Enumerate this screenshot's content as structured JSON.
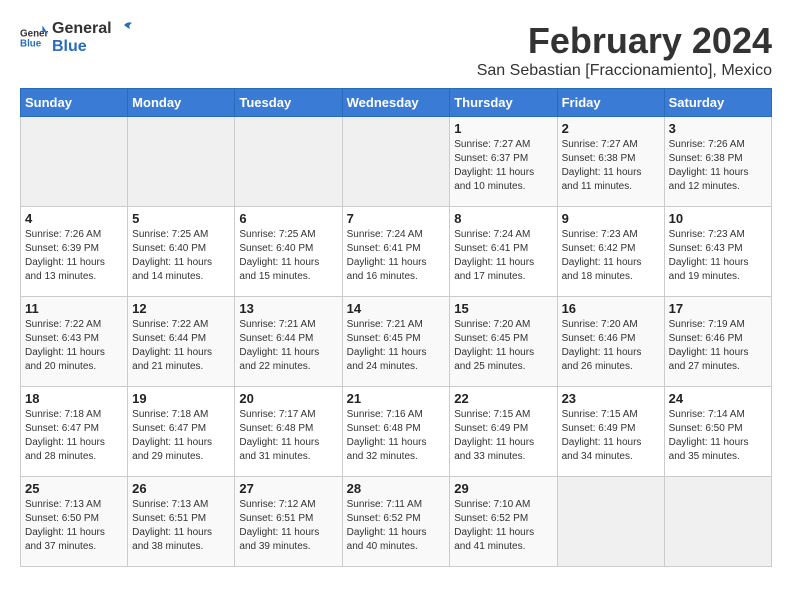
{
  "logo": {
    "general": "General",
    "blue": "Blue"
  },
  "title": "February 2024",
  "subtitle": "San Sebastian [Fraccionamiento], Mexico",
  "days_of_week": [
    "Sunday",
    "Monday",
    "Tuesday",
    "Wednesday",
    "Thursday",
    "Friday",
    "Saturday"
  ],
  "weeks": [
    [
      {
        "date": "",
        "info": ""
      },
      {
        "date": "",
        "info": ""
      },
      {
        "date": "",
        "info": ""
      },
      {
        "date": "",
        "info": ""
      },
      {
        "date": "1",
        "sunrise": "Sunrise: 7:27 AM",
        "sunset": "Sunset: 6:37 PM",
        "daylight": "Daylight: 11 hours and 10 minutes."
      },
      {
        "date": "2",
        "sunrise": "Sunrise: 7:27 AM",
        "sunset": "Sunset: 6:38 PM",
        "daylight": "Daylight: 11 hours and 11 minutes."
      },
      {
        "date": "3",
        "sunrise": "Sunrise: 7:26 AM",
        "sunset": "Sunset: 6:38 PM",
        "daylight": "Daylight: 11 hours and 12 minutes."
      }
    ],
    [
      {
        "date": "4",
        "sunrise": "Sunrise: 7:26 AM",
        "sunset": "Sunset: 6:39 PM",
        "daylight": "Daylight: 11 hours and 13 minutes."
      },
      {
        "date": "5",
        "sunrise": "Sunrise: 7:25 AM",
        "sunset": "Sunset: 6:40 PM",
        "daylight": "Daylight: 11 hours and 14 minutes."
      },
      {
        "date": "6",
        "sunrise": "Sunrise: 7:25 AM",
        "sunset": "Sunset: 6:40 PM",
        "daylight": "Daylight: 11 hours and 15 minutes."
      },
      {
        "date": "7",
        "sunrise": "Sunrise: 7:24 AM",
        "sunset": "Sunset: 6:41 PM",
        "daylight": "Daylight: 11 hours and 16 minutes."
      },
      {
        "date": "8",
        "sunrise": "Sunrise: 7:24 AM",
        "sunset": "Sunset: 6:41 PM",
        "daylight": "Daylight: 11 hours and 17 minutes."
      },
      {
        "date": "9",
        "sunrise": "Sunrise: 7:23 AM",
        "sunset": "Sunset: 6:42 PM",
        "daylight": "Daylight: 11 hours and 18 minutes."
      },
      {
        "date": "10",
        "sunrise": "Sunrise: 7:23 AM",
        "sunset": "Sunset: 6:43 PM",
        "daylight": "Daylight: 11 hours and 19 minutes."
      }
    ],
    [
      {
        "date": "11",
        "sunrise": "Sunrise: 7:22 AM",
        "sunset": "Sunset: 6:43 PM",
        "daylight": "Daylight: 11 hours and 20 minutes."
      },
      {
        "date": "12",
        "sunrise": "Sunrise: 7:22 AM",
        "sunset": "Sunset: 6:44 PM",
        "daylight": "Daylight: 11 hours and 21 minutes."
      },
      {
        "date": "13",
        "sunrise": "Sunrise: 7:21 AM",
        "sunset": "Sunset: 6:44 PM",
        "daylight": "Daylight: 11 hours and 22 minutes."
      },
      {
        "date": "14",
        "sunrise": "Sunrise: 7:21 AM",
        "sunset": "Sunset: 6:45 PM",
        "daylight": "Daylight: 11 hours and 24 minutes."
      },
      {
        "date": "15",
        "sunrise": "Sunrise: 7:20 AM",
        "sunset": "Sunset: 6:45 PM",
        "daylight": "Daylight: 11 hours and 25 minutes."
      },
      {
        "date": "16",
        "sunrise": "Sunrise: 7:20 AM",
        "sunset": "Sunset: 6:46 PM",
        "daylight": "Daylight: 11 hours and 26 minutes."
      },
      {
        "date": "17",
        "sunrise": "Sunrise: 7:19 AM",
        "sunset": "Sunset: 6:46 PM",
        "daylight": "Daylight: 11 hours and 27 minutes."
      }
    ],
    [
      {
        "date": "18",
        "sunrise": "Sunrise: 7:18 AM",
        "sunset": "Sunset: 6:47 PM",
        "daylight": "Daylight: 11 hours and 28 minutes."
      },
      {
        "date": "19",
        "sunrise": "Sunrise: 7:18 AM",
        "sunset": "Sunset: 6:47 PM",
        "daylight": "Daylight: 11 hours and 29 minutes."
      },
      {
        "date": "20",
        "sunrise": "Sunrise: 7:17 AM",
        "sunset": "Sunset: 6:48 PM",
        "daylight": "Daylight: 11 hours and 31 minutes."
      },
      {
        "date": "21",
        "sunrise": "Sunrise: 7:16 AM",
        "sunset": "Sunset: 6:48 PM",
        "daylight": "Daylight: 11 hours and 32 minutes."
      },
      {
        "date": "22",
        "sunrise": "Sunrise: 7:15 AM",
        "sunset": "Sunset: 6:49 PM",
        "daylight": "Daylight: 11 hours and 33 minutes."
      },
      {
        "date": "23",
        "sunrise": "Sunrise: 7:15 AM",
        "sunset": "Sunset: 6:49 PM",
        "daylight": "Daylight: 11 hours and 34 minutes."
      },
      {
        "date": "24",
        "sunrise": "Sunrise: 7:14 AM",
        "sunset": "Sunset: 6:50 PM",
        "daylight": "Daylight: 11 hours and 35 minutes."
      }
    ],
    [
      {
        "date": "25",
        "sunrise": "Sunrise: 7:13 AM",
        "sunset": "Sunset: 6:50 PM",
        "daylight": "Daylight: 11 hours and 37 minutes."
      },
      {
        "date": "26",
        "sunrise": "Sunrise: 7:13 AM",
        "sunset": "Sunset: 6:51 PM",
        "daylight": "Daylight: 11 hours and 38 minutes."
      },
      {
        "date": "27",
        "sunrise": "Sunrise: 7:12 AM",
        "sunset": "Sunset: 6:51 PM",
        "daylight": "Daylight: 11 hours and 39 minutes."
      },
      {
        "date": "28",
        "sunrise": "Sunrise: 7:11 AM",
        "sunset": "Sunset: 6:52 PM",
        "daylight": "Daylight: 11 hours and 40 minutes."
      },
      {
        "date": "29",
        "sunrise": "Sunrise: 7:10 AM",
        "sunset": "Sunset: 6:52 PM",
        "daylight": "Daylight: 11 hours and 41 minutes."
      },
      {
        "date": "",
        "info": ""
      },
      {
        "date": "",
        "info": ""
      }
    ]
  ]
}
